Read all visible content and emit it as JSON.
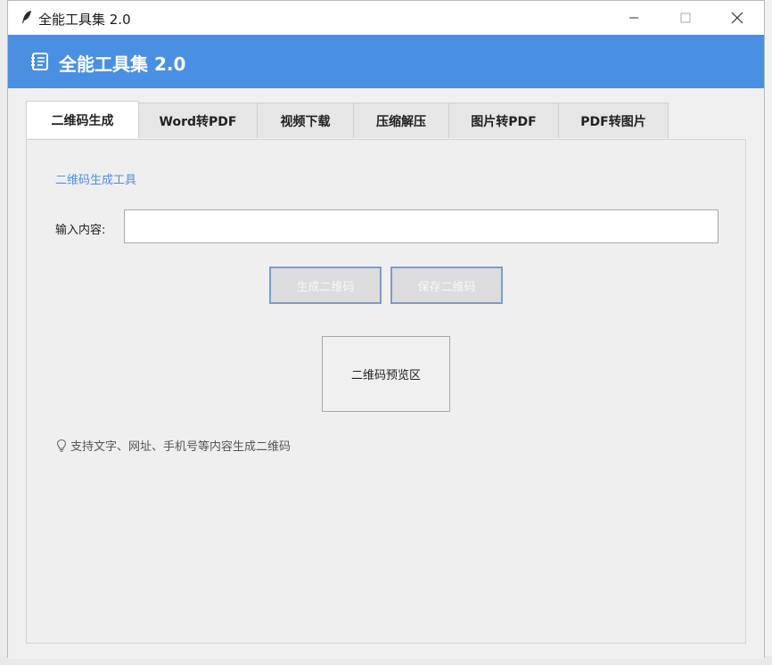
{
  "window": {
    "title": "全能工具集 2.0"
  },
  "header": {
    "title": "全能工具集 2.0"
  },
  "tabs": [
    {
      "label": "二维码生成",
      "active": true
    },
    {
      "label": "Word转PDF",
      "active": false
    },
    {
      "label": "视频下载",
      "active": false
    },
    {
      "label": "压缩解压",
      "active": false
    },
    {
      "label": "图片转PDF",
      "active": false
    },
    {
      "label": "PDF转图片",
      "active": false
    }
  ],
  "qr": {
    "section_title": "二维码生成工具",
    "input_label": "输入内容:",
    "input_value": "",
    "generate_label": "生成二维码",
    "save_label": "保存二维码",
    "preview_label": "二维码预览区",
    "hint_text": "支持文字、网址、手机号等内容生成二维码"
  },
  "colors": {
    "header": "#4a90e2",
    "accent_text": "#4a90e2",
    "button_border": "#7d9cc7"
  },
  "icons": {
    "app": "feather-icon",
    "header": "notebook-icon",
    "hint": "lightbulb-icon"
  }
}
